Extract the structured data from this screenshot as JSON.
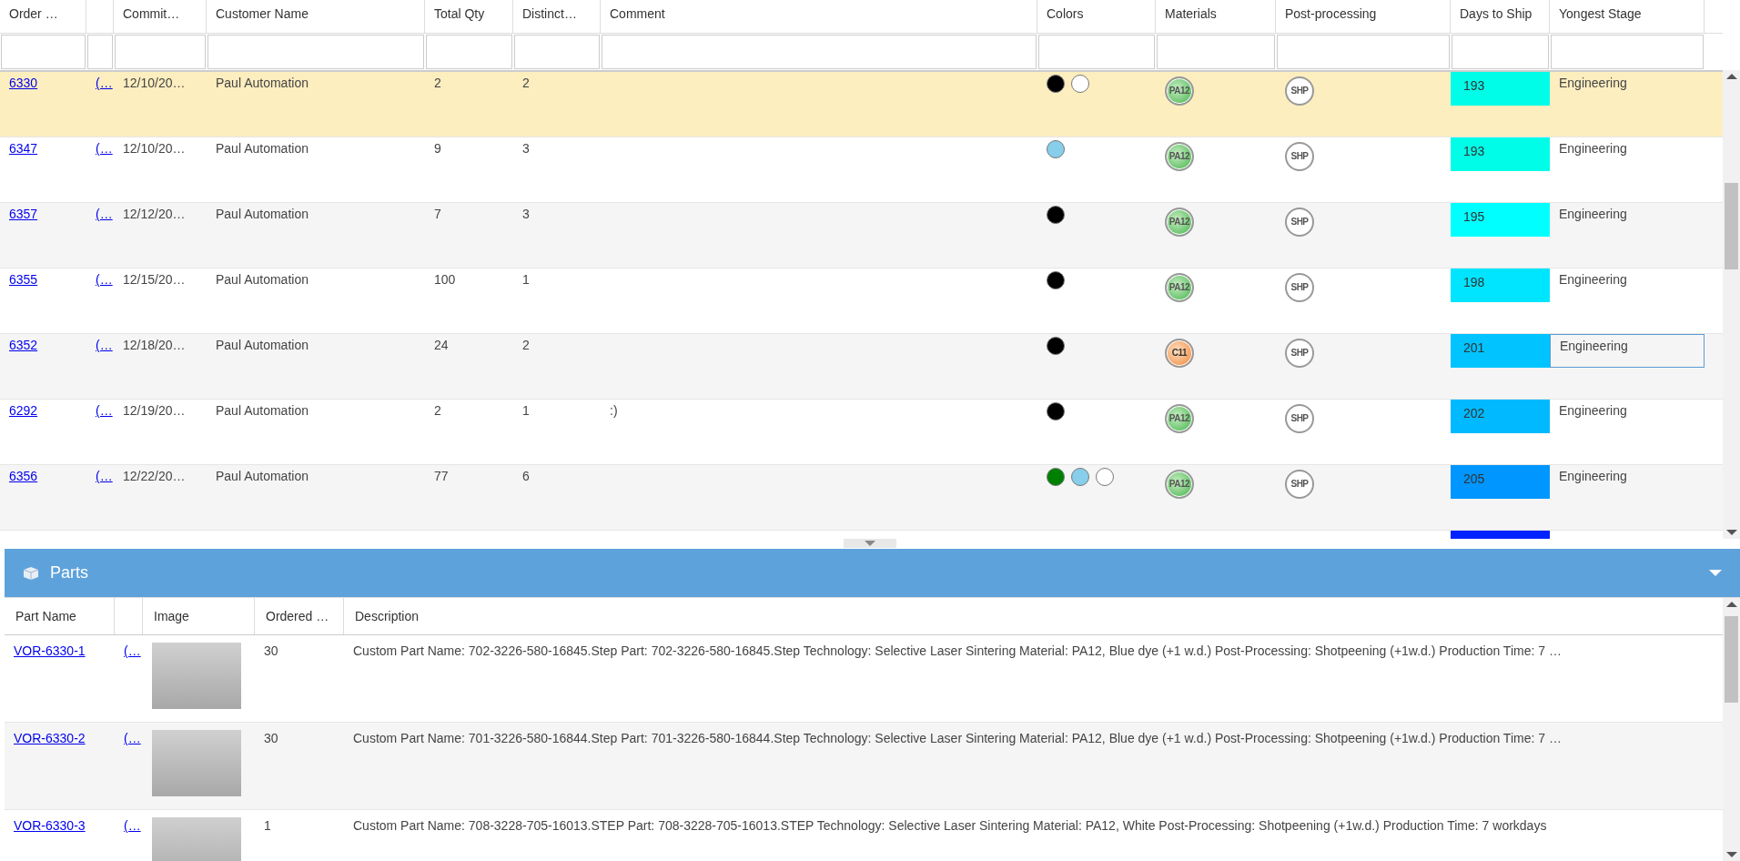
{
  "orders": {
    "columns": [
      "Order …",
      "",
      "Commit…",
      "Customer Name",
      "Total Qty",
      "Distinct…",
      "Comment",
      "Colors",
      "Materials",
      "Post-processing",
      "Days to Ship",
      "Yongest Stage"
    ],
    "rows": [
      {
        "order": "6330",
        "link": "(…",
        "commit": "12/10/20…",
        "customer": "Paul Automation",
        "qty": "2",
        "distinct": "2",
        "comment": "",
        "colors": [
          {
            "color": "#000000"
          },
          {
            "color": "#ffffff"
          }
        ],
        "material": {
          "label": "PA12",
          "kind": "pa"
        },
        "post": "SHP",
        "days": {
          "text": "193",
          "color": "#00fde8"
        },
        "stage": "Engineering",
        "selected": true,
        "focused": false
      },
      {
        "order": "6347",
        "link": "(…",
        "commit": "12/10/20…",
        "customer": "Paul Automation",
        "qty": "9",
        "distinct": "3",
        "comment": "",
        "colors": [
          {
            "color": "#87ceeb"
          }
        ],
        "material": {
          "label": "PA12",
          "kind": "pa"
        },
        "post": "SHP",
        "days": {
          "text": "193",
          "color": "#00fde8"
        },
        "stage": "Engineering",
        "selected": false,
        "focused": false
      },
      {
        "order": "6357",
        "link": "(…",
        "commit": "12/12/20…",
        "customer": "Paul Automation",
        "qty": "7",
        "distinct": "3",
        "comment": "",
        "colors": [
          {
            "color": "#000000"
          }
        ],
        "material": {
          "label": "PA12",
          "kind": "pa"
        },
        "post": "SHP",
        "days": {
          "text": "195",
          "color": "#00ffff"
        },
        "stage": "Engineering",
        "selected": false,
        "focused": false
      },
      {
        "order": "6355",
        "link": "(…",
        "commit": "12/15/20…",
        "customer": "Paul Automation",
        "qty": "100",
        "distinct": "1",
        "comment": "",
        "colors": [
          {
            "color": "#000000"
          }
        ],
        "material": {
          "label": "PA12",
          "kind": "pa"
        },
        "post": "SHP",
        "days": {
          "text": "198",
          "color": "#00e5ff"
        },
        "stage": "Engineering",
        "selected": false,
        "focused": false
      },
      {
        "order": "6352",
        "link": "(…",
        "commit": "12/18/20…",
        "customer": "Paul Automation",
        "qty": "24",
        "distinct": "2",
        "comment": "",
        "colors": [
          {
            "color": "#000000"
          }
        ],
        "material": {
          "label": "C11",
          "kind": "c"
        },
        "post": "SHP",
        "days": {
          "text": "201",
          "color": "#00c3ff"
        },
        "stage": "Engineering",
        "selected": false,
        "focused": true
      },
      {
        "order": "6292",
        "link": "(…",
        "commit": "12/19/20…",
        "customer": "Paul Automation",
        "qty": "2",
        "distinct": "1",
        "comment": ":)",
        "colors": [
          {
            "color": "#000000"
          }
        ],
        "material": {
          "label": "PA12",
          "kind": "pa"
        },
        "post": "SHP",
        "days": {
          "text": "202",
          "color": "#00b9ff"
        },
        "stage": "Engineering",
        "selected": false,
        "focused": false
      },
      {
        "order": "6356",
        "link": "(…",
        "commit": "12/22/20…",
        "customer": "Paul Automation",
        "qty": "77",
        "distinct": "6",
        "comment": "",
        "colors": [
          {
            "color": "#008000"
          },
          {
            "color": "#87ceeb"
          },
          {
            "color": "#ffffff"
          }
        ],
        "material": {
          "label": "PA12",
          "kind": "pa"
        },
        "post": "SHP",
        "days": {
          "text": "205",
          "color": "#0096ff"
        },
        "stage": "Engineering",
        "selected": false,
        "focused": false
      }
    ],
    "partial_row": {
      "days": {
        "color": "#0022ff"
      }
    }
  },
  "parts": {
    "title": "Parts",
    "columns": [
      "Part Name",
      "",
      "Image",
      "Ordered …",
      "Description"
    ],
    "rows": [
      {
        "name": "VOR-6330-1",
        "link": "(…",
        "qty": "30",
        "description": "Custom Part Name: 702-3226-580-16845.Step Part: 702-3226-580-16845.Step Technology: Selective Laser Sintering Material: PA12, Blue dye (+1 w.d.) Post-Processing: Shotpeening (+1w.d.) Production Time: 7 …"
      },
      {
        "name": "VOR-6330-2",
        "link": "(…",
        "qty": "30",
        "description": "Custom Part Name: 701-3226-580-16844.Step Part: 701-3226-580-16844.Step Technology: Selective Laser Sintering Material: PA12, Blue dye (+1 w.d.) Post-Processing: Shotpeening (+1w.d.) Production Time: 7 …"
      },
      {
        "name": "VOR-6330-3",
        "link": "(…",
        "qty": "1",
        "description": "Custom Part Name: 708-3228-705-16013.STEP Part: 708-3228-705-16013.STEP Technology: Selective Laser Sintering Material: PA12, White Post-Processing: Shotpeening (+1w.d.) Production Time: 7 workdays"
      }
    ]
  }
}
